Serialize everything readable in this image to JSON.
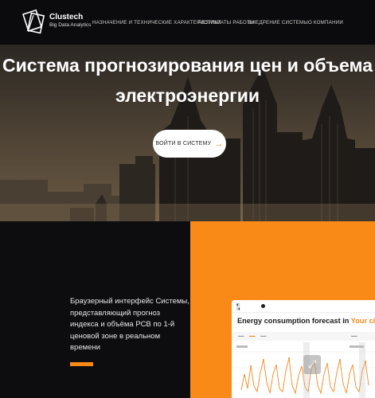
{
  "header": {
    "brand_name": "Clustech",
    "brand_sub": "Big Data Analytics",
    "nav": [
      "НАЗНАЧЕНИЕ И ТЕХНИЧЕСКИЕ ХАРАКТЕРИСТИКИ",
      "РЕЗУЛЬТАТЫ РАБОТЫ",
      "ВНЕДРЕНИЕ СИСТЕМЫ",
      "О КОМПАНИИ"
    ]
  },
  "hero": {
    "title_line1": "Система прогнозирования цен и объема",
    "title_line2": "электроэнергии",
    "cta_label": "ВОЙТИ В СИСТЕМУ",
    "cta_icon": "arrow-right-icon"
  },
  "about": {
    "description": "Браузерный интерфейс Системы, представляющий прогноз индекса и объёма РСВ по 1-й ценовой зоне в реальном времени"
  },
  "preview": {
    "title_main": "Energy consumption forecast in",
    "title_city": "Your city",
    "title_suffix": "▾",
    "expand_icon": "expand-icon"
  },
  "colors": {
    "accent": "#fa8a17",
    "dark": "#0d0d10"
  }
}
